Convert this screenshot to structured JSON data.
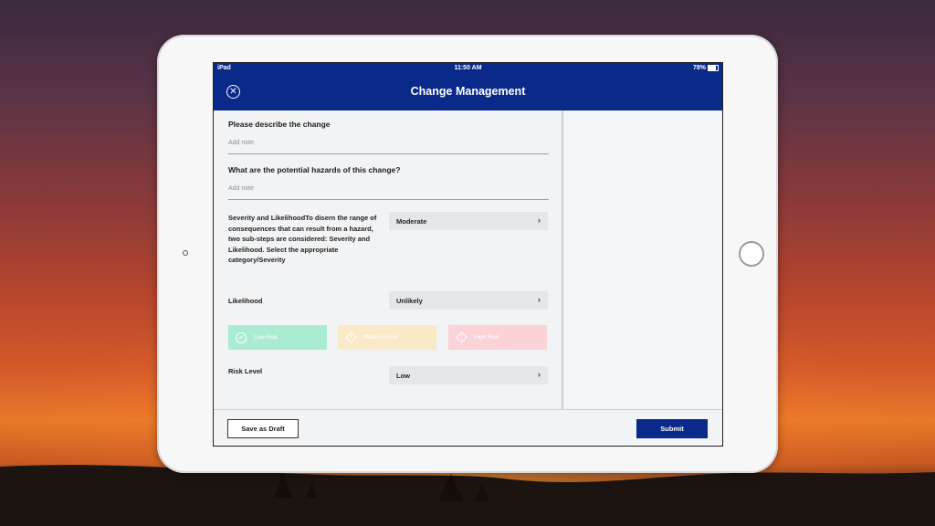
{
  "status": {
    "carrier": "iPad",
    "time": "11:50 AM",
    "battery": "78%",
    "battery_level": 0.78
  },
  "header": {
    "title": "Change Management",
    "close_icon": "close-circle-icon"
  },
  "form": {
    "q1": {
      "label": "Please describe the change",
      "placeholder": "Add note"
    },
    "q2": {
      "label": "What are the potential hazards of this change?",
      "placeholder": "Add note"
    },
    "severity": {
      "description": "Severity and LikelihoodTo disern the range of consequences that can result from a hazard, two sub-steps are considered: Severity and Likelihood. Select the appropriate category/Severity",
      "value": "Moderate"
    },
    "likelihood": {
      "label": "Likelihood",
      "value": "Unlikely"
    },
    "risk_options": [
      {
        "label": "Low Risk",
        "icon": "check-circle-icon",
        "color": "#a9ecd2"
      },
      {
        "label": "Medium Risk",
        "icon": "warning-diamond-icon",
        "color": "#f9e9c6"
      },
      {
        "label": "High Risk",
        "icon": "warning-diamond-icon",
        "color": "#fbd2d6"
      }
    ],
    "risk_level": {
      "label": "Risk Level",
      "value": "Low"
    }
  },
  "footer": {
    "draft_label": "Save as Draft",
    "submit_label": "Submit"
  },
  "colors": {
    "brand": "#0a2a8a"
  }
}
